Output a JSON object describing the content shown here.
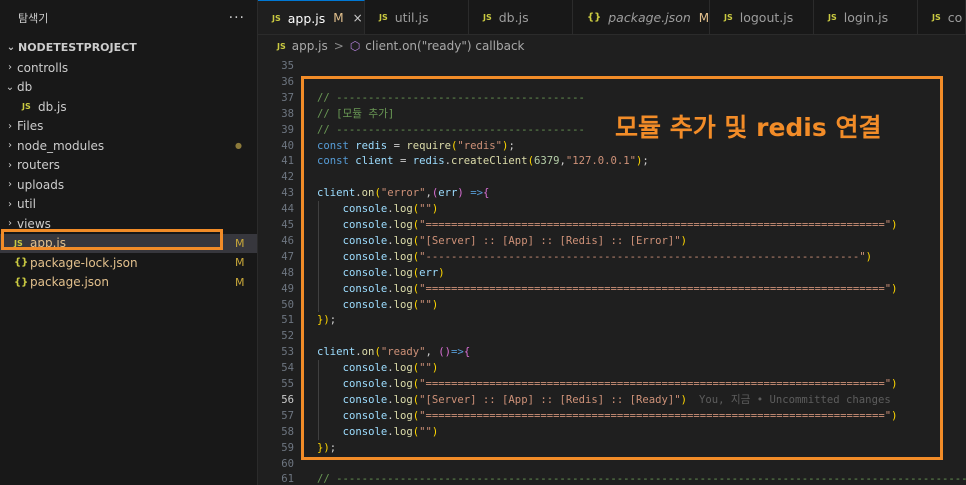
{
  "sidebar": {
    "title": "탐색기",
    "more": "···",
    "project": "NODETESTPROJECT",
    "items": [
      {
        "label": "controlls",
        "kind": "folder",
        "state": "collapsed"
      },
      {
        "label": "db",
        "kind": "folder",
        "state": "expanded"
      },
      {
        "label": "db.js",
        "kind": "js-file",
        "icon": "JS"
      },
      {
        "label": "Files",
        "kind": "folder",
        "state": "collapsed"
      },
      {
        "label": "node_modules",
        "kind": "folder",
        "state": "collapsed",
        "decoration": "●"
      },
      {
        "label": "routers",
        "kind": "folder",
        "state": "collapsed"
      },
      {
        "label": "uploads",
        "kind": "folder",
        "state": "collapsed"
      },
      {
        "label": "util",
        "kind": "folder",
        "state": "collapsed"
      },
      {
        "label": "views",
        "kind": "folder",
        "state": "collapsed"
      },
      {
        "label": "app.js",
        "kind": "js-file",
        "icon": "JS",
        "status": "M",
        "selected": true
      },
      {
        "label": "package-lock.json",
        "kind": "json-file",
        "icon": "{}",
        "status": "M"
      },
      {
        "label": "package.json",
        "kind": "json-file",
        "icon": "{}",
        "status": "M"
      }
    ]
  },
  "tabs": [
    {
      "label": "app.js",
      "icon": "JS",
      "status": "M",
      "close": "×",
      "active": true
    },
    {
      "label": "util.js",
      "icon": "JS"
    },
    {
      "label": "db.js",
      "icon": "JS"
    },
    {
      "label": "package.json",
      "icon": "{}",
      "status": "M",
      "italic": true
    },
    {
      "label": "logout.js",
      "icon": "JS"
    },
    {
      "label": "login.js",
      "icon": "JS"
    },
    {
      "label": "co",
      "icon": "JS"
    }
  ],
  "breadcrumb": {
    "file_icon": "JS",
    "file": "app.js",
    "separator": ">",
    "symbol": "client.on(\"ready\") callback"
  },
  "annotation": "모듈 추가 및 redis 연결",
  "editor": {
    "current_line": 56,
    "lines": [
      {
        "n": "35",
        "text": ""
      },
      {
        "n": "36",
        "text": ""
      },
      {
        "n": "37",
        "text": "// ---------------------------------------"
      },
      {
        "n": "38",
        "text": "// [모듈 추가]"
      },
      {
        "n": "39",
        "text": "// ---------------------------------------"
      },
      {
        "n": "40",
        "text": "const redis = require(\"redis\");"
      },
      {
        "n": "41",
        "text": "const client = redis.createClient(6379,\"127.0.0.1\");"
      },
      {
        "n": "42",
        "text": ""
      },
      {
        "n": "43",
        "text": "client.on(\"error\",(err) =>{"
      },
      {
        "n": "44",
        "text": "    console.log(\"\")"
      },
      {
        "n": "45",
        "text": "    console.log(\"========================================================================\")"
      },
      {
        "n": "46",
        "text": "    console.log(\"[Server] :: [App] :: [Redis] :: [Error]\")"
      },
      {
        "n": "47",
        "text": "    console.log(\"--------------------------------------------------------------------\")"
      },
      {
        "n": "48",
        "text": "    console.log(err)"
      },
      {
        "n": "49",
        "text": "    console.log(\"========================================================================\")"
      },
      {
        "n": "50",
        "text": "    console.log(\"\")"
      },
      {
        "n": "51",
        "text": "});"
      },
      {
        "n": "52",
        "text": ""
      },
      {
        "n": "53",
        "text": "client.on(\"ready\", ()=>{"
      },
      {
        "n": "54",
        "text": "    console.log(\"\")"
      },
      {
        "n": "55",
        "text": "    console.log(\"========================================================================\")"
      },
      {
        "n": "56",
        "text": "    console.log(\"[Server] :: [App] :: [Redis] :: [Ready]\")",
        "blame": "You, 지금 • Uncommitted changes"
      },
      {
        "n": "57",
        "text": "    console.log(\"========================================================================\")"
      },
      {
        "n": "58",
        "text": "    console.log(\"\")"
      },
      {
        "n": "59",
        "text": "});"
      },
      {
        "n": "60",
        "text": ""
      },
      {
        "n": "61",
        "text": "// -------------------------------------------------------------------------------------------------------"
      }
    ]
  }
}
